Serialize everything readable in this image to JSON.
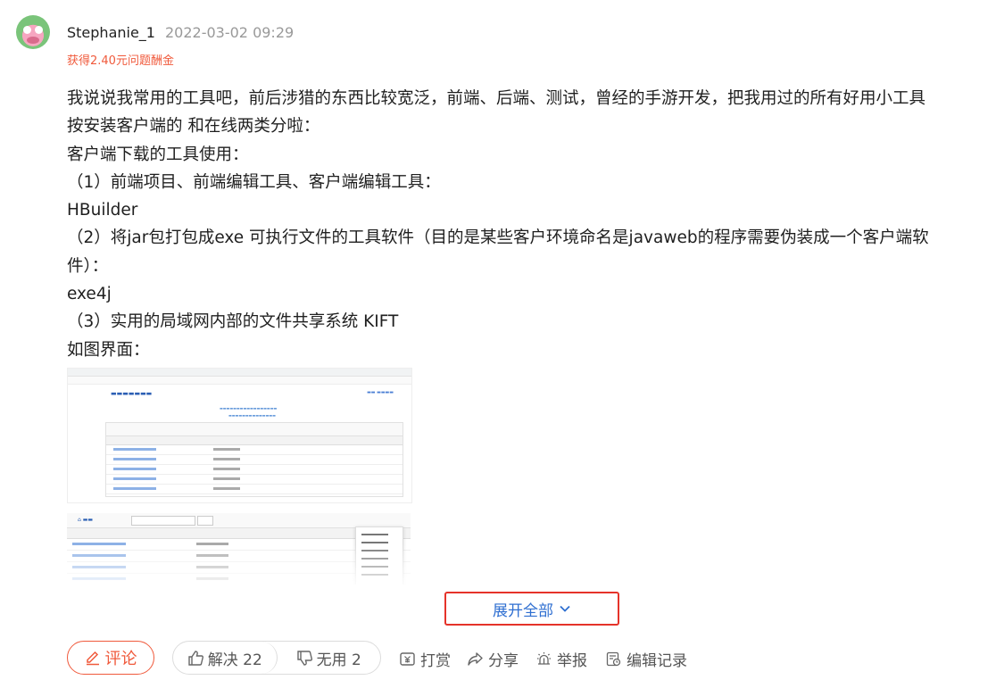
{
  "post": {
    "user_name": "Stephanie_1",
    "time": "2022-03-02 09:29",
    "bounty": "获得2.40元问题酬金",
    "content_lines": [
      "我说说我常用的工具吧，前后涉猎的东西比较宽泛，前端、后端、测试，曾经的手游开发，把我用过的所有好用小工具",
      "按安装客户端的 和在线两类分啦：",
      "客户端下载的工具使用：",
      "（1）前端项目、前端编辑工具、客户端编辑工具：",
      "HBuilder",
      "（2）将jar包打包成exe 可执行文件的工具软件（目的是某些客户环境命名是javaweb的程序需要伪装成一个客户端软",
      "件）：",
      "exe4j",
      "（3）实用的局域网内部的文件共享系统 KIFT",
      "如图界面："
    ]
  },
  "expand_label": "展开全部",
  "actions": {
    "comment": "评论",
    "solved": "解决 22",
    "useless": "无用 2",
    "reward": "打赏",
    "share": "分享",
    "report": "举报",
    "edit_log": "编辑记录"
  },
  "colors": {
    "accent": "#f05a3c",
    "link": "#2f6fd1",
    "highlight_border": "#e5332a"
  }
}
